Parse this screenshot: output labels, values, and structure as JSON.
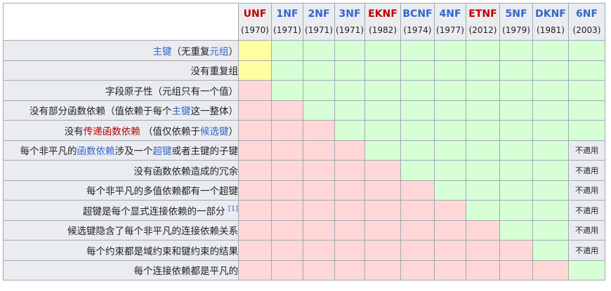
{
  "columns": [
    {
      "name": "UNF",
      "year": "(1970)",
      "link_color": "red"
    },
    {
      "name": "1NF",
      "year": "(1971)",
      "link_color": "blue"
    },
    {
      "name": "2NF",
      "year": "(1971)",
      "link_color": "blue"
    },
    {
      "name": "3NF",
      "year": "(1971)",
      "link_color": "blue"
    },
    {
      "name": "EKNF",
      "year": "(1982)",
      "link_color": "red"
    },
    {
      "name": "BCNF",
      "year": "(1974)",
      "link_color": "blue"
    },
    {
      "name": "4NF",
      "year": "(1977)",
      "link_color": "blue"
    },
    {
      "name": "ETNF",
      "year": "(2012)",
      "link_color": "red"
    },
    {
      "name": "5NF",
      "year": "(1979)",
      "link_color": "blue"
    },
    {
      "name": "DKNF",
      "year": "(1981)",
      "link_color": "blue"
    },
    {
      "name": "6NF",
      "year": "(2003)",
      "link_color": "blue"
    }
  ],
  "rows": [
    {
      "label": [
        {
          "text": "主键",
          "link": "blue"
        },
        {
          "text": "（无重复"
        },
        {
          "text": "元组",
          "link": "blue"
        },
        {
          "text": "）"
        }
      ],
      "cells": [
        "y",
        "g",
        "g",
        "g",
        "g",
        "g",
        "g",
        "g",
        "g",
        "g",
        "g"
      ]
    },
    {
      "label": [
        {
          "text": "没有重复组"
        }
      ],
      "cells": [
        "y",
        "g",
        "g",
        "g",
        "g",
        "g",
        "g",
        "g",
        "g",
        "g",
        "g"
      ]
    },
    {
      "label": [
        {
          "text": "字段原子性（元组只有一个值）"
        }
      ],
      "cells": [
        "r",
        "g",
        "g",
        "g",
        "g",
        "g",
        "g",
        "g",
        "g",
        "g",
        "g"
      ]
    },
    {
      "label": [
        {
          "text": "没有部分函数依赖（值依赖于每个"
        },
        {
          "text": "主键",
          "link": "blue"
        },
        {
          "text": "这一整体）"
        }
      ],
      "cells": [
        "r",
        "r",
        "g",
        "g",
        "g",
        "g",
        "g",
        "g",
        "g",
        "g",
        "g"
      ]
    },
    {
      "label": [
        {
          "text": "没有"
        },
        {
          "text": "传递函数依赖",
          "link": "red"
        },
        {
          "text": " （值仅依赖于"
        },
        {
          "text": "候选键",
          "link": "blue"
        },
        {
          "text": "）"
        }
      ],
      "cells": [
        "r",
        "r",
        "r",
        "g",
        "g",
        "g",
        "g",
        "g",
        "g",
        "g",
        "g"
      ]
    },
    {
      "label": [
        {
          "text": "每个非平凡的"
        },
        {
          "text": "函数依赖",
          "link": "blue"
        },
        {
          "text": "涉及一个"
        },
        {
          "text": "超键",
          "link": "blue"
        },
        {
          "text": "或者主键的子键"
        }
      ],
      "cells": [
        "r",
        "r",
        "r",
        "r",
        "g",
        "g",
        "g",
        "g",
        "g",
        "g",
        "na"
      ]
    },
    {
      "label": [
        {
          "text": "没有函数依赖造成的冗余"
        }
      ],
      "cells": [
        "r",
        "r",
        "r",
        "r",
        "r",
        "g",
        "g",
        "g",
        "g",
        "g",
        "na"
      ]
    },
    {
      "label": [
        {
          "text": "每个非平凡的多值依赖都有一个超键"
        }
      ],
      "cells": [
        "r",
        "r",
        "r",
        "r",
        "r",
        "r",
        "g",
        "g",
        "g",
        "g",
        "na"
      ]
    },
    {
      "label": [
        {
          "text": "超键是每个显式连接依赖的一部分 "
        },
        {
          "text": "[1]",
          "sup": true
        }
      ],
      "cells": [
        "r",
        "r",
        "r",
        "r",
        "r",
        "r",
        "r",
        "g",
        "g",
        "g",
        "na"
      ]
    },
    {
      "label": [
        {
          "text": "候选键隐含了每个非平凡的连接依赖关系"
        }
      ],
      "cells": [
        "r",
        "r",
        "r",
        "r",
        "r",
        "r",
        "r",
        "r",
        "g",
        "g",
        "na"
      ]
    },
    {
      "label": [
        {
          "text": "每个约束都是域约束和键约束的结果"
        }
      ],
      "cells": [
        "r",
        "r",
        "r",
        "r",
        "r",
        "r",
        "r",
        "r",
        "r",
        "g",
        "na"
      ]
    },
    {
      "label": [
        {
          "text": "每个连接依赖都是平凡的"
        }
      ],
      "cells": [
        "r",
        "r",
        "r",
        "r",
        "r",
        "r",
        "r",
        "r",
        "r",
        "r",
        "g"
      ]
    }
  ],
  "na_text": "不適用",
  "colors": {
    "yellow": "#ffffa0",
    "green": "#d6ffd6",
    "red": "#ffd7d7",
    "na": "#eaecf0",
    "link_blue": "#3366cc",
    "link_red": "#ba0000"
  }
}
